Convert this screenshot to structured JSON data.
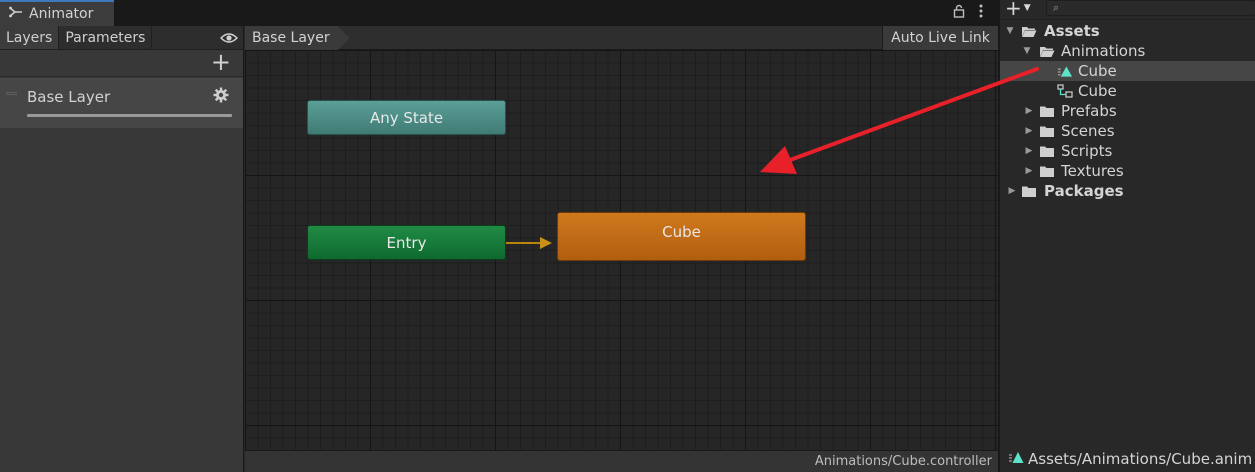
{
  "animator": {
    "tab_title": "Animator",
    "left_tabs": {
      "layers": "Layers",
      "parameters": "Parameters"
    },
    "add_label": "+",
    "layer": {
      "name": "Base Layer"
    },
    "breadcrumb": "Base Layer",
    "auto_live_link": "Auto Live Link",
    "states": {
      "any_state": "Any State",
      "entry": "Entry",
      "cube": "Cube"
    },
    "status_path": "Animations/Cube.controller"
  },
  "project": {
    "create_label": "+",
    "search_placeholder": "",
    "tree": [
      {
        "label": "Assets",
        "bold": true
      },
      {
        "label": "Animations"
      },
      {
        "label": "Cube",
        "kind": "animation-clip",
        "selected": true
      },
      {
        "label": "Cube",
        "kind": "animator-controller"
      },
      {
        "label": "Prefabs"
      },
      {
        "label": "Scenes"
      },
      {
        "label": "Scripts"
      },
      {
        "label": "Textures"
      },
      {
        "label": "Packages",
        "bold": true
      }
    ],
    "selected_path": "Assets/Animations/Cube.anim"
  },
  "colors": {
    "any_state": "#4f8f87",
    "entry": "#17793a",
    "cube_state": "#c46c16",
    "annotation_arrow": "#e8202a",
    "clip_icon": "#5fe0c8"
  },
  "icons": {
    "animator_tab": "animator-icon",
    "lock": "lock-icon",
    "menu": "kebab-menu-icon",
    "eye": "eye-icon",
    "gear": "gear-icon",
    "folder": "folder-icon",
    "folder_open": "folder-open-icon",
    "clip": "animation-clip-icon",
    "controller": "animator-controller-icon"
  }
}
